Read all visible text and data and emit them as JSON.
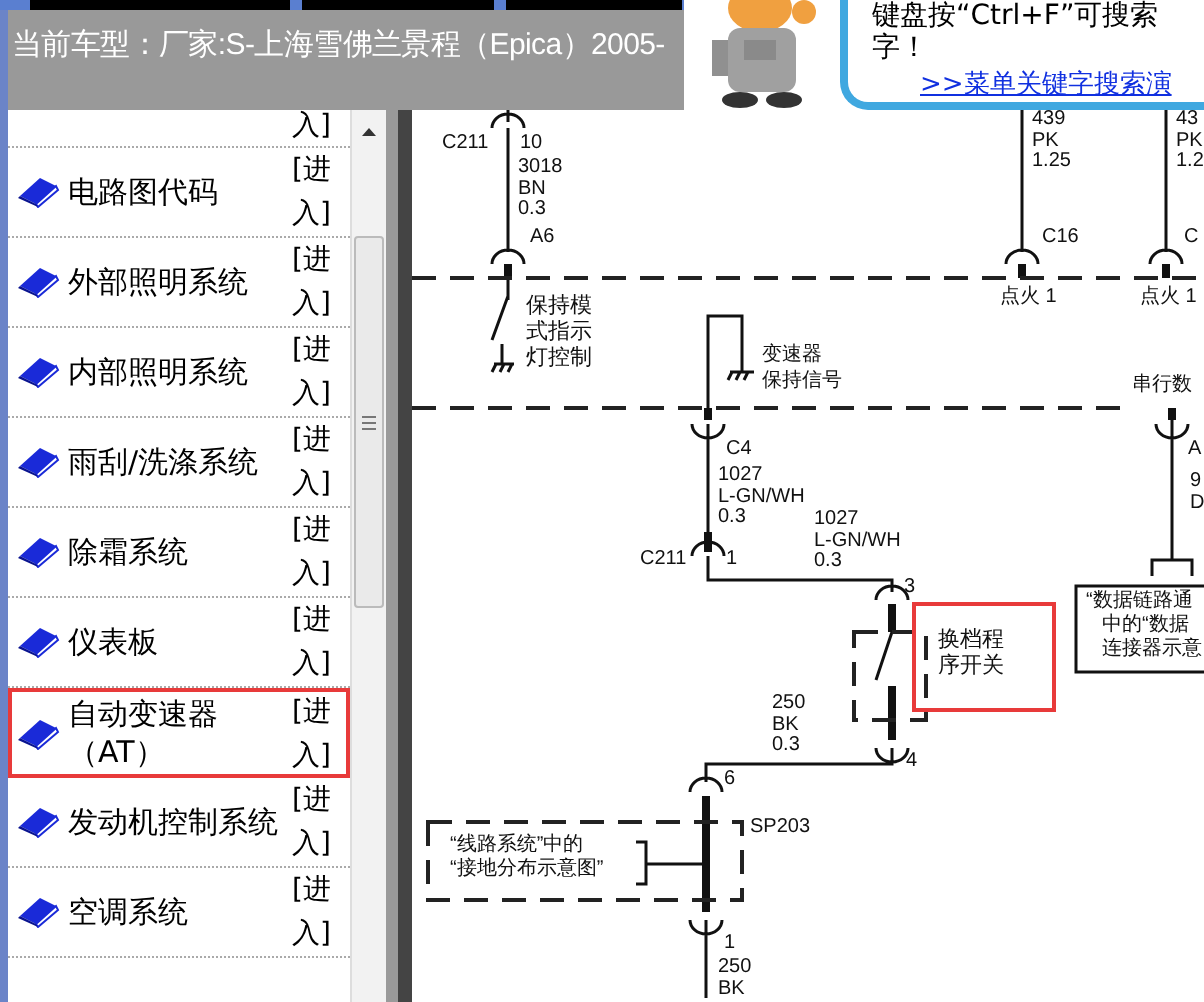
{
  "header": {
    "title": "当前车型：厂家:S-上海雪佛兰景程（Epica）2005-"
  },
  "tip": {
    "line_1": "键盘按“Ctrl+F”可搜索",
    "line_2": "字！",
    "link": ">>菜单关键字搜索演"
  },
  "sidebar": {
    "items": [
      {
        "kind": "cut",
        "enter": "入]",
        "highlighted": false
      },
      {
        "kind": "full",
        "label": "电路图代码",
        "enter": "[进入]",
        "highlighted": false
      },
      {
        "kind": "full",
        "label": "外部照明系统",
        "enter": "[进入]",
        "highlighted": false
      },
      {
        "kind": "full",
        "label": "内部照明系统",
        "enter": "[进入]",
        "highlighted": false
      },
      {
        "kind": "full",
        "label": "雨刮/洗涤系统",
        "enter": "[进入]",
        "highlighted": false
      },
      {
        "kind": "full",
        "label": "除霜系统",
        "enter": "[进入]",
        "highlighted": false
      },
      {
        "kind": "full",
        "label": "仪表板",
        "enter": "[进入]",
        "highlighted": false
      },
      {
        "kind": "full",
        "label": "自动变速器（AT）",
        "enter": "[进入]",
        "highlighted": true
      },
      {
        "kind": "full",
        "label": "发动机控制系统",
        "enter": "[进入]",
        "highlighted": false
      },
      {
        "kind": "full",
        "label": "空调系统",
        "enter": "[进入]",
        "highlighted": false
      }
    ]
  },
  "diagram": {
    "labels": [
      {
        "text": "C211",
        "highlighted": false
      },
      {
        "text": "10",
        "highlighted": false
      },
      {
        "text": "3018\nBN\n0.3",
        "highlighted": false
      },
      {
        "text": "A6",
        "highlighted": false
      },
      {
        "text": "439\nPK\n1.25",
        "highlighted": false
      },
      {
        "text": "C16",
        "highlighted": false
      },
      {
        "text": "43\nPK\n1.2",
        "highlighted": false
      },
      {
        "text": "C",
        "highlighted": false
      },
      {
        "text": "保持模式指示灯控制",
        "highlighted": false
      },
      {
        "text": "点火 1",
        "highlighted": false
      },
      {
        "text": "点火 1",
        "highlighted": false
      },
      {
        "text": "变速器",
        "highlighted": false
      },
      {
        "text": "保持信号",
        "highlighted": false
      },
      {
        "text": "串行数",
        "highlighted": false
      },
      {
        "text": "C4",
        "highlighted": false
      },
      {
        "text": "1027\nL-GN/WH\n0.3",
        "highlighted": false
      },
      {
        "text": "A",
        "highlighted": false
      },
      {
        "text": "9\nD",
        "highlighted": false
      },
      {
        "text": "C211",
        "highlighted": false
      },
      {
        "text": "1",
        "highlighted": false
      },
      {
        "text": "1027\nL-GN/WH\n0.3",
        "highlighted": false
      },
      {
        "text": "3",
        "highlighted": false
      },
      {
        "text": "“数据链路通",
        "highlighted": false
      },
      {
        "text": "中的“数据",
        "highlighted": false
      },
      {
        "text": "连接器示意",
        "highlighted": false
      },
      {
        "text": "换档程序开关",
        "highlighted": true
      },
      {
        "text": "250\nBK\n0.3",
        "highlighted": false
      },
      {
        "text": "4",
        "highlighted": false
      },
      {
        "text": "6",
        "highlighted": false
      },
      {
        "text": "SP203",
        "highlighted": false
      },
      {
        "text": "“线路系统”中的",
        "highlighted": false
      },
      {
        "text": "“接地分布示意图”",
        "highlighted": false
      },
      {
        "text": "1",
        "highlighted": false
      },
      {
        "text": "250\nBK",
        "highlighted": false
      }
    ]
  }
}
